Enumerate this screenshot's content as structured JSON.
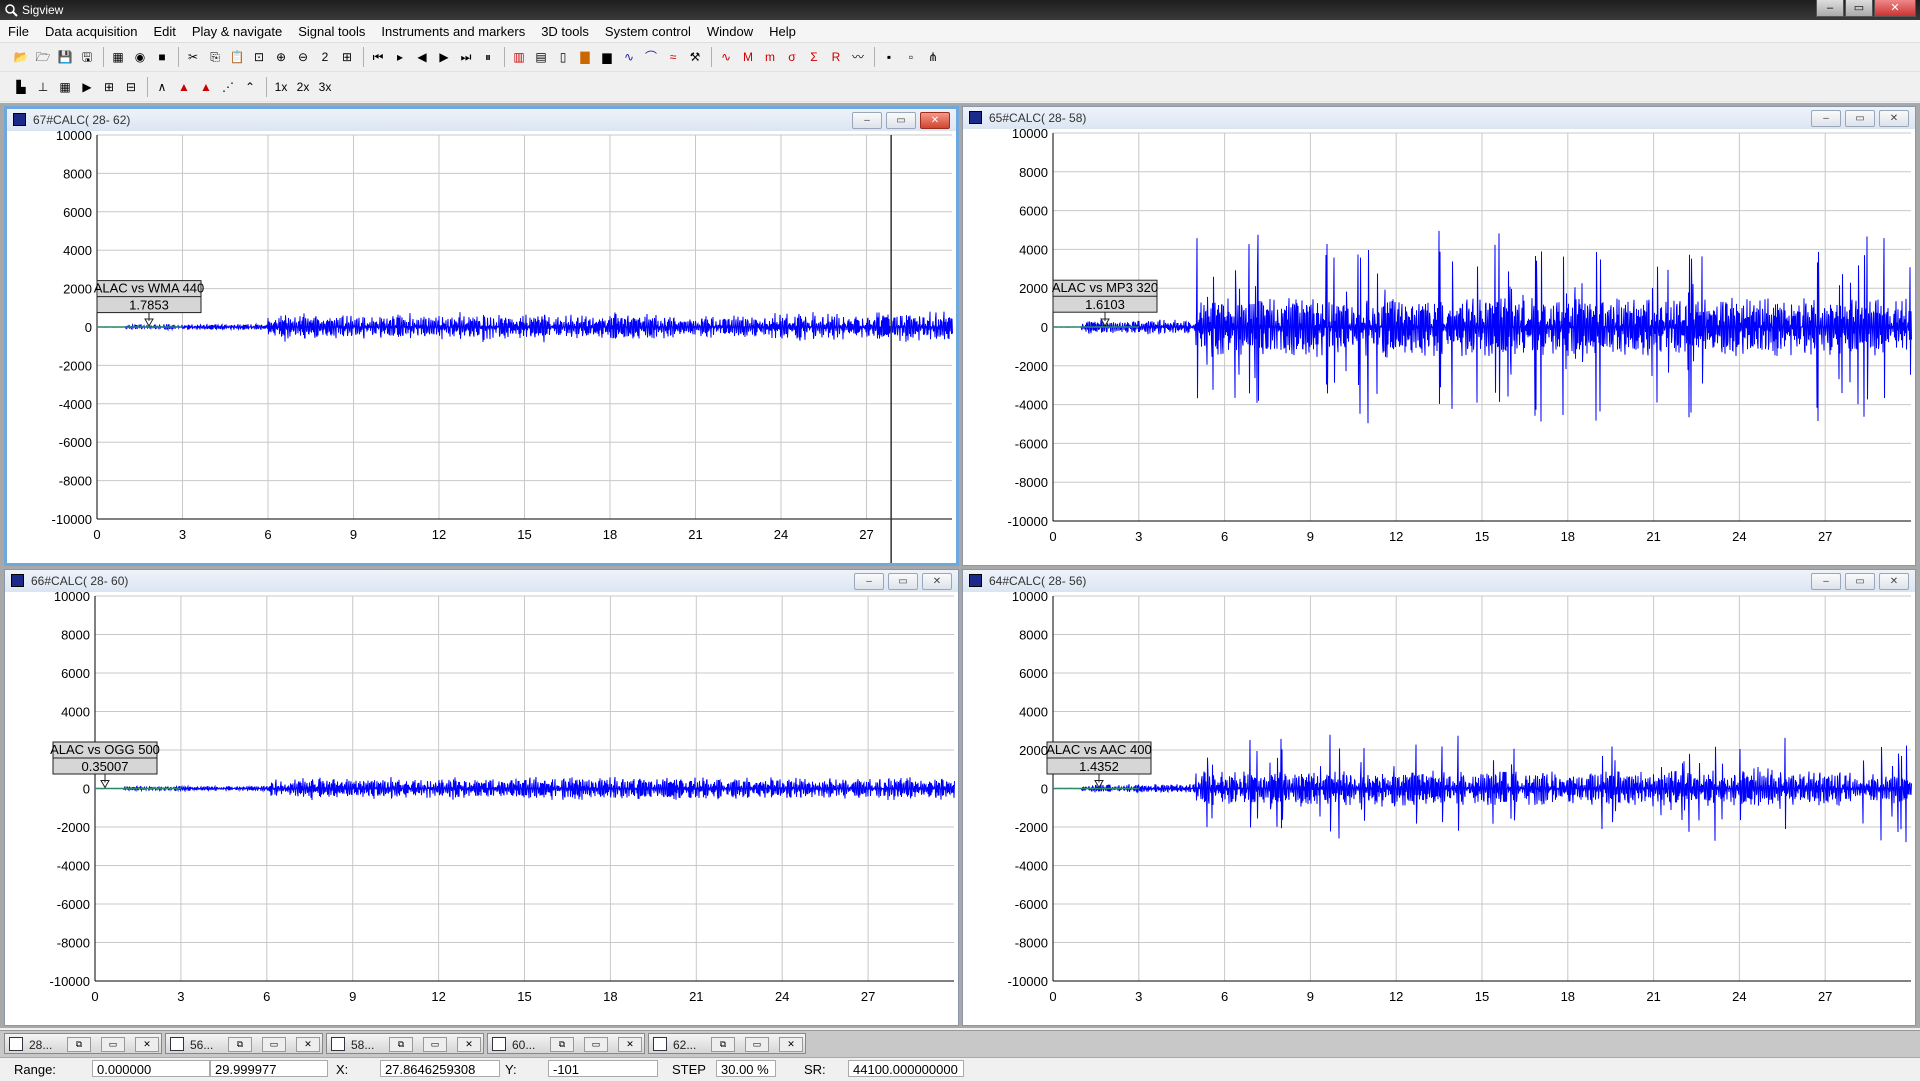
{
  "window": {
    "title": "Sigview",
    "controls": [
      "–",
      "▭",
      "✕"
    ]
  },
  "menu": [
    "File",
    "Data acquisition",
    "Edit",
    "Play & navigate",
    "Signal tools",
    "Instruments and markers",
    "3D tools",
    "System control",
    "Window",
    "Help"
  ],
  "toolbar1_icons": [
    "open-icon",
    "open-folder-icon",
    "save-icon",
    "save-as-icon",
    "sep",
    "record-icon",
    "rec-icon",
    "stop-icon",
    "sep",
    "cut-icon",
    "copy-icon",
    "paste-icon",
    "zoom-window-icon",
    "zoom-in-icon",
    "zoom-out-icon",
    "zoom-2x-icon",
    "zoom-fit-icon",
    "sep",
    "first-icon",
    "play-icon",
    "prev-marker-icon",
    "next-marker-icon",
    "last-icon",
    "pause-icon",
    "sep",
    "fft-icon",
    "spectrogram-icon",
    "calculator-icon",
    "bar-icon",
    "histogram-icon",
    "wave-icon",
    "filter-icon",
    "envelope-icon",
    "tools-icon",
    "sep",
    "rms-icon",
    "max-icon",
    "min-icon",
    "stdev-icon",
    "sum-icon",
    "rms2-icon",
    "wave-gen-icon",
    "sep",
    "tile-icon",
    "cascade-icon",
    "tree-icon"
  ],
  "toolbar1_labels": {
    "rec": "rec",
    "stop": "stop",
    "zoom2x": "2ˣ",
    "max": "MAX",
    "min": "MIN",
    "stdev": "StDv",
    "sum": "SUM",
    "rms": "RMS"
  },
  "toolbar2_icons": [
    "chart-icon",
    "axis-icon",
    "grid-icon",
    "marker-icon",
    "resize-icon",
    "resize2-icon",
    "sep",
    "line-mode-icon",
    "peak-mode-icon",
    "fill-mode-icon",
    "dot-mode-icon",
    "step-mode-icon",
    "sep",
    "x1-icon",
    "x2-icon",
    "x3-icon"
  ],
  "toolbar2_labels": {
    "x1": "1x",
    "x2": "2x",
    "x3": "3x"
  },
  "windows": [
    {
      "title": "67#CALC( 28- 62)",
      "label": "ALAC vs WMA 440",
      "value": "1.7853",
      "active": true,
      "amplitude": 0.06,
      "onset": 6,
      "burst": 0.02
    },
    {
      "title": "65#CALC( 28- 58)",
      "label": "ALAC vs MP3 320",
      "value": "1.6103",
      "active": false,
      "amplitude": 0.15,
      "onset": 5,
      "burst": 0.35
    },
    {
      "title": "66#CALC( 28- 60)",
      "label": "ALAC vs OGG 500",
      "value": "0.35007",
      "active": false,
      "amplitude": 0.05,
      "onset": 6,
      "burst": 0.01
    },
    {
      "title": "64#CALC( 28- 56)",
      "label": "ALAC vs AAC 400",
      "value": "1.4352",
      "active": false,
      "amplitude": 0.09,
      "onset": 5,
      "burst": 0.19
    }
  ],
  "chart_data": {
    "type": "line",
    "xlim": [
      0,
      30
    ],
    "ylim": [
      -10000,
      10000
    ],
    "x_ticks": [
      0,
      3,
      6,
      9,
      12,
      15,
      18,
      21,
      24,
      27
    ],
    "y_ticks": [
      10000,
      8000,
      6000,
      4000,
      2000,
      0,
      -2000,
      -4000,
      -6000,
      -8000,
      -10000
    ],
    "cursor_x": 27.8646259308,
    "grid": true
  },
  "taskbar": [
    "28...",
    "56...",
    "58...",
    "60...",
    "62..."
  ],
  "status": {
    "range_label": "Range:",
    "range_start": "0.000000",
    "range_end": "29.999977",
    "x_label": "X:",
    "x_value": "27.8646259308",
    "y_label": "Y:",
    "y_value": "-101",
    "step_label": "STEP",
    "step_value": "30.00 %",
    "sr_label": "SR:",
    "sr_value": "44100.000000000"
  },
  "colors": {
    "signal": "#0000ff",
    "grid": "#c8c8c8",
    "active_border": "#6fa8dc",
    "mdi_bg": "#a8a8a8"
  }
}
